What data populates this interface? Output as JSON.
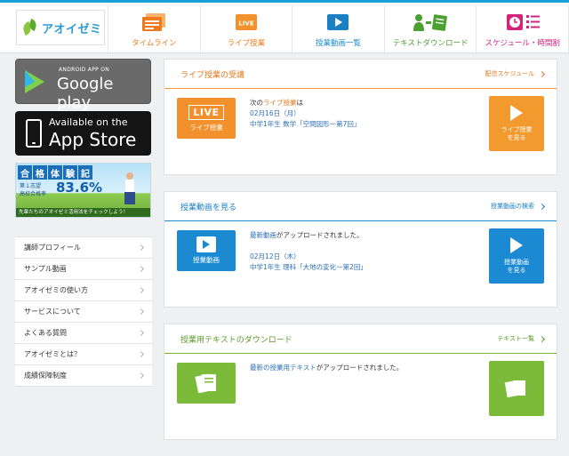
{
  "logo": {
    "text": "アオイゼミ"
  },
  "nav": [
    {
      "label": "タイムライン",
      "icon": "timeline-icon"
    },
    {
      "label": "ライブ授業",
      "icon": "live-icon",
      "badge": "LIVE"
    },
    {
      "label": "授業動画一覧",
      "icon": "video-play-icon"
    },
    {
      "label": "テキストダウンロード",
      "icon": "text-download-icon"
    },
    {
      "label": "スケジュール・時間割",
      "icon": "schedule-icon"
    }
  ],
  "stores": {
    "google": {
      "small": "ANDROID APP ON",
      "big": "Google play"
    },
    "apple": {
      "small": "Available on the",
      "big": "App Store"
    }
  },
  "promo": {
    "title_chars": [
      "合",
      "格",
      "体",
      "験",
      "記"
    ],
    "sub1": "第１志望",
    "sub2": "高校合格率",
    "rate": "83.6%",
    "caption": "先輩たちのアオイゼミ活用法をチェックしよう！"
  },
  "menu": [
    "講師プロフィール",
    "サンプル動画",
    "アオイゼミの使い方",
    "サービスについて",
    "よくある質問",
    "アオイゼミとは？",
    "成績保障制度"
  ],
  "cards": {
    "live": {
      "title": "ライブ授業の受講",
      "link": "配信スケジュール",
      "thumb_badge": "LIVE",
      "thumb_caption": "ライブ授業",
      "line1_pre": "次の",
      "line1_hl": "ライブ授業",
      "line1_post": "は",
      "date": "02月16日（月）",
      "course": "中学1年生 数学「空間図形ー第7回」",
      "action_line1": "ライブ授業",
      "action_line2": "を見る"
    },
    "video": {
      "title": "授業動画を見る",
      "link": "授業動画の検索",
      "thumb_caption": "授業動画",
      "line1_hl": "最新動画",
      "line1_post": "がアップロードされました。",
      "date": "02月12日（木）",
      "course": "中学1年生 理科「大地の変化ー第2回」",
      "action_line1": "授業動画",
      "action_line2": "を見る"
    },
    "text": {
      "title": "授業用テキストのダウンロード",
      "link": "テキスト一覧",
      "line1_hl": "最新の授業用テキスト",
      "line1_post": "がアップロードされました。"
    }
  },
  "colors": {
    "brand_blue": "#1aa1d8",
    "live_orange": "#f2902b",
    "video_blue": "#1b8ad3",
    "text_green": "#7cbb3a",
    "schedule_pink": "#d4237b"
  }
}
